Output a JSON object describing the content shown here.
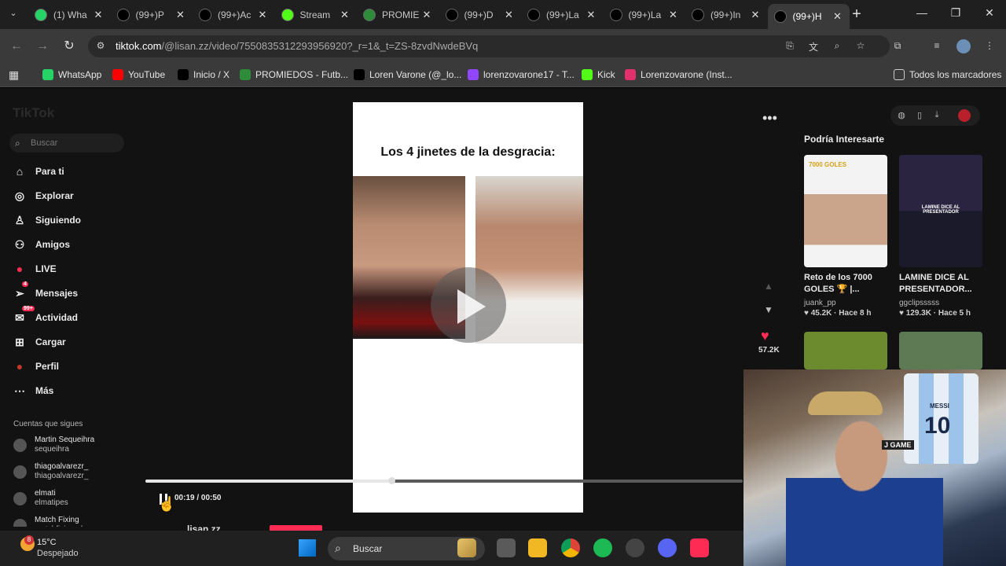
{
  "browser": {
    "tabs": [
      {
        "label": "(1) Wha",
        "favicon": "whatsapp-icon",
        "color": "#25d366",
        "active": false
      },
      {
        "label": "(99+)P",
        "favicon": "tiktok-icon",
        "color": "#000000",
        "active": false
      },
      {
        "label": "(99+)Ac",
        "favicon": "tiktok-icon",
        "color": "#000000",
        "active": false
      },
      {
        "label": "Stream",
        "favicon": "kick-icon",
        "color": "#53fc18",
        "active": false
      },
      {
        "label": "PROMIE",
        "favicon": "promiedos-icon",
        "color": "#2e8b3a",
        "active": false
      },
      {
        "label": "(99+)D",
        "favicon": "tiktok-icon",
        "color": "#000000",
        "active": false
      },
      {
        "label": "(99+)La",
        "favicon": "tiktok-icon",
        "color": "#000000",
        "active": false
      },
      {
        "label": "(99+)La",
        "favicon": "tiktok-icon",
        "color": "#000000",
        "active": false
      },
      {
        "label": "(99+)In",
        "favicon": "tiktok-icon",
        "color": "#000000",
        "active": false
      },
      {
        "label": "(99+)H",
        "favicon": "tiktok-icon",
        "color": "#000000",
        "active": true
      }
    ],
    "url_host": "tiktok.com",
    "url_path": "/@lisan.zz/video/7550835312293956920?_r=1&_t=ZS-8zvdNwdeBVq",
    "bookmarks": [
      {
        "label": "WhatsApp",
        "icon": "whatsapp-icon",
        "color": "#25d366"
      },
      {
        "label": "YouTube",
        "icon": "youtube-icon",
        "color": "#ff0000"
      },
      {
        "label": "Inicio / X",
        "icon": "x-icon",
        "color": "#000000"
      },
      {
        "label": "PROMIEDOS - Futb...",
        "icon": "promiedos-icon",
        "color": "#2e8b3a"
      },
      {
        "label": "Loren Varone (@_lo...",
        "icon": "tiktok-icon",
        "color": "#000000"
      },
      {
        "label": "lorenzovarone17 - T...",
        "icon": "twitch-icon",
        "color": "#9146ff"
      },
      {
        "label": "Kick",
        "icon": "kick-icon",
        "color": "#53fc18"
      },
      {
        "label": "Lorenzovarone (Inst...",
        "icon": "instagram-icon",
        "color": "#e1306c"
      }
    ],
    "all_bookmarks": "Todos los marcadores"
  },
  "tiktok": {
    "logo": "TikTok",
    "search_placeholder": "Buscar",
    "nav": [
      {
        "label": "Para ti",
        "icon": "home-icon"
      },
      {
        "label": "Explorar",
        "icon": "compass-icon"
      },
      {
        "label": "Siguiendo",
        "icon": "following-icon"
      },
      {
        "label": "Amigos",
        "icon": "friends-icon"
      },
      {
        "label": "LIVE",
        "icon": "live-icon"
      },
      {
        "label": "Mensajes",
        "icon": "messages-icon",
        "badge": "4"
      },
      {
        "label": "Actividad",
        "icon": "activity-icon",
        "badge": "99+"
      },
      {
        "label": "Cargar",
        "icon": "upload-icon"
      },
      {
        "label": "Perfil",
        "icon": "profile-icon"
      },
      {
        "label": "Más",
        "icon": "more-icon"
      }
    ],
    "following_title": "Cuentas que sigues",
    "following": [
      {
        "name": "Martin Sequeihra",
        "user": "sequeihra"
      },
      {
        "name": "thiagoalvarezr_",
        "user": "thiagoalvarezr_"
      },
      {
        "name": "elmati",
        "user": "elmatipes"
      },
      {
        "name": "Match Fixing",
        "user": "matchfixing.ok"
      }
    ],
    "video": {
      "title": "Los 4 jinetes de la desgracia:",
      "time": "00:19 / 00:50",
      "progress": 0.42,
      "author": "lisan.zz",
      "likes": "57.2K"
    },
    "right_panel": {
      "title": "Podría Interesarte",
      "cards": [
        {
          "title": "Reto de los 7000 GOLES 🏆 |...",
          "user": "juank_pp",
          "likes": "45.2K",
          "age": "Hace 8 h",
          "thumb_text": "7000 GOLES"
        },
        {
          "title": "LAMINE DICE AL PRESENTADOR...",
          "user": "ggclipsssss",
          "likes": "129.3K",
          "age": "Hace 5 h",
          "thumb_text": "LAMINE DICE AL PRESENTADOR"
        }
      ]
    }
  },
  "webcam": {
    "jersey_name": "MESSI",
    "jersey_number": "10",
    "cap_text": "J GAME"
  },
  "taskbar": {
    "temperature": "15°C",
    "weather": "Despejado",
    "weather_badge": "8",
    "search_label": "Buscar"
  }
}
